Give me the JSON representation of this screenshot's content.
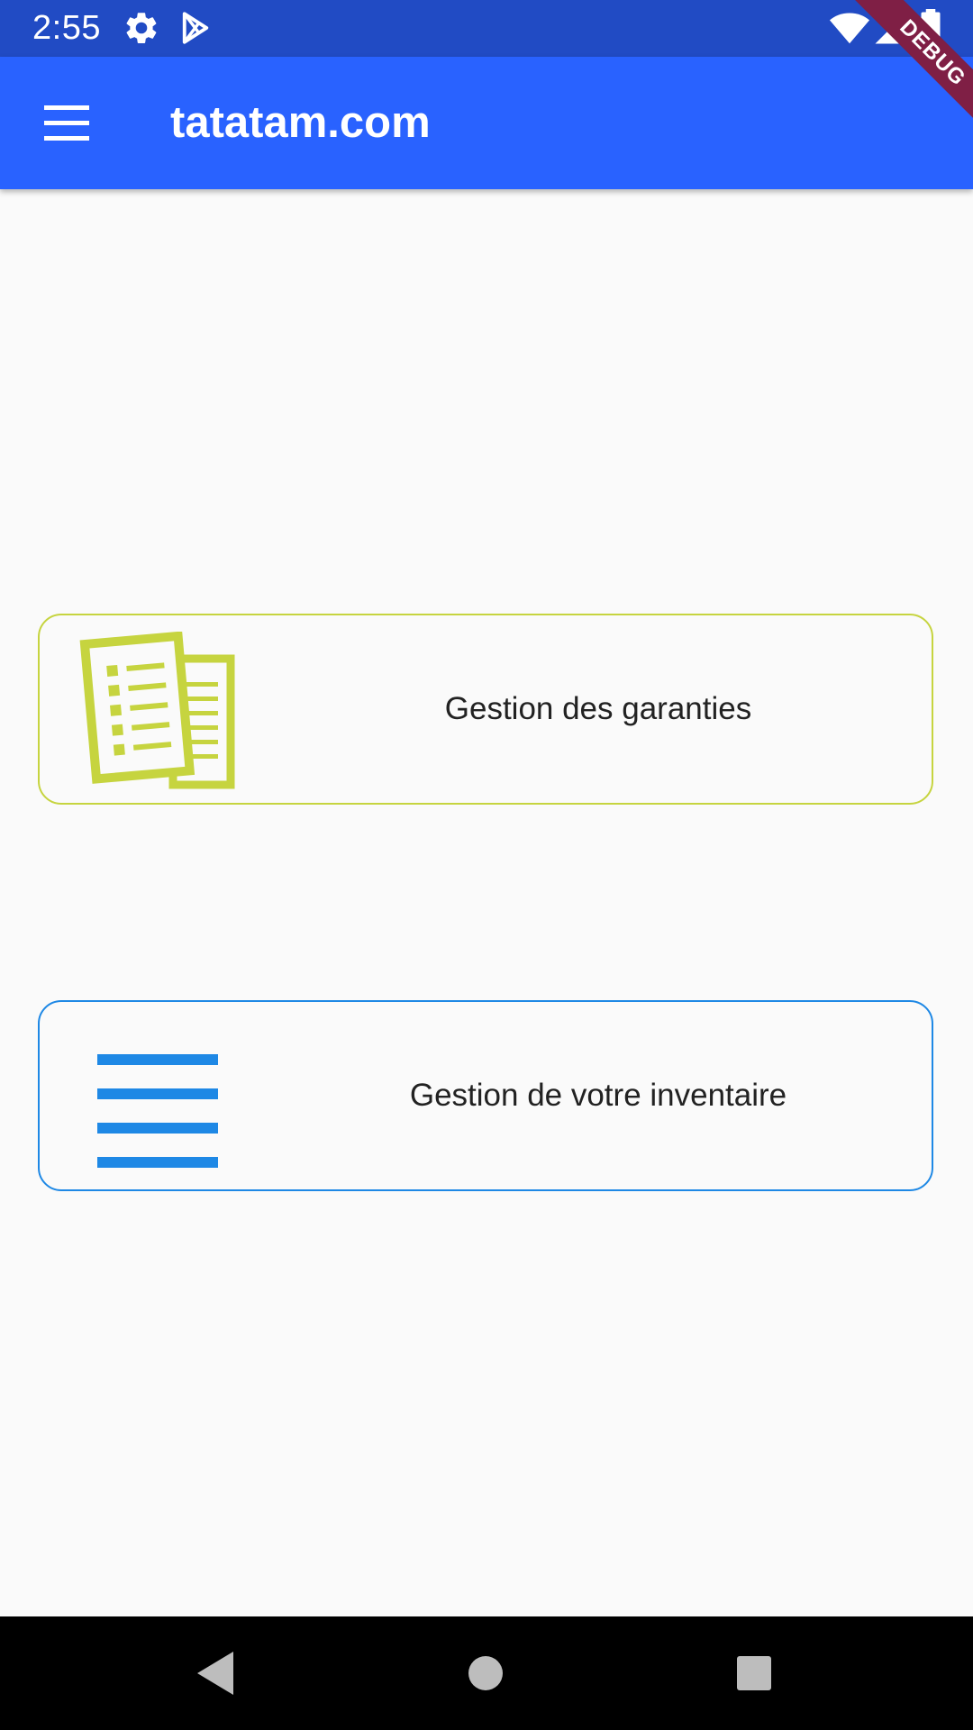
{
  "status_bar": {
    "time": "2:55",
    "icons": [
      "gear-icon",
      "play-store-icon",
      "wifi-icon",
      "signal-icon",
      "battery-icon"
    ],
    "color": "#214bc4"
  },
  "debug_banner": {
    "label": "DEBUG",
    "color": "#7f1f45"
  },
  "app_bar": {
    "menu_icon": "menu-icon",
    "title": "tatatam.com",
    "color": "#2962ff"
  },
  "cards": [
    {
      "label": "Gestion des garanties",
      "icon": "documents-icon",
      "accent": "#c6d43f"
    },
    {
      "label": "Gestion de votre inventaire",
      "icon": "list-icon",
      "accent": "#1e88e5"
    }
  ],
  "nav_bar": {
    "buttons": [
      "back-icon",
      "home-icon",
      "recents-icon"
    ]
  }
}
